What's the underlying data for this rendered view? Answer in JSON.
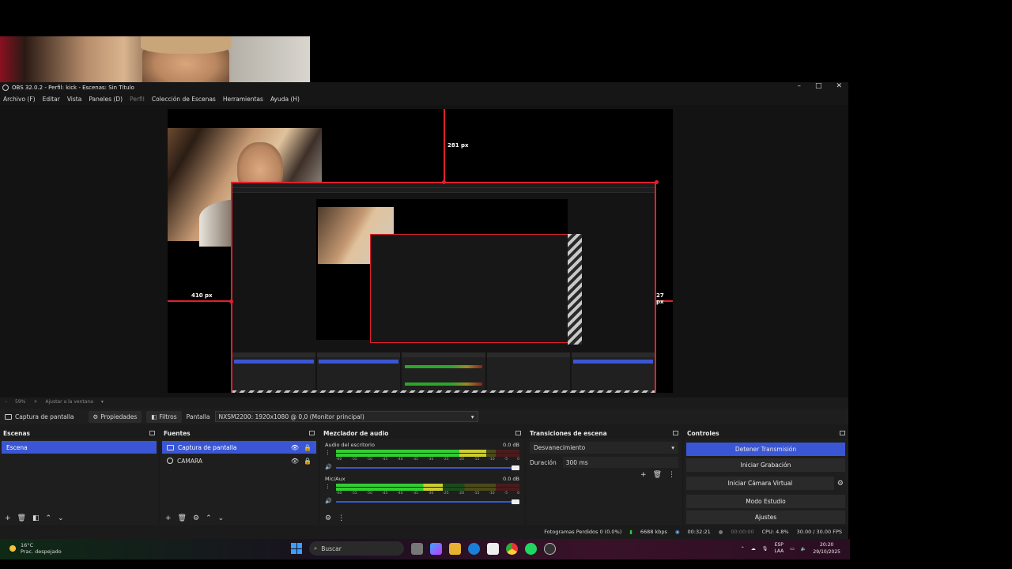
{
  "window": {
    "title": "OBS 32.0.2 - Perfil: kick - Escenas: Sin Título"
  },
  "menu": [
    "Archivo (F)",
    "Editar",
    "Vista",
    "Paneles (D)",
    "Perfil",
    "Colección de Escenas",
    "Herramientas",
    "Ayuda (H)"
  ],
  "preview": {
    "top_offset": "281 px",
    "left_offset": "410 px",
    "right_offset": "27 px"
  },
  "zoom": {
    "value": "59%",
    "fit_label": "Ajustar a la ventana"
  },
  "source_toolbar": {
    "source_name": "Captura de pantalla",
    "properties_label": "Propiedades",
    "filters_label": "Filtros",
    "display_label": "Pantalla",
    "display_value": "NXSM2200: 1920x1080 @ 0,0 (Monitor principal)"
  },
  "scenes": {
    "title": "Escenas",
    "items": [
      "Escena"
    ]
  },
  "sources": {
    "title": "Fuentes",
    "items": [
      "Captura de pantalla",
      "CAMARA"
    ]
  },
  "mixer": {
    "title": "Mezclador de audio",
    "tracks": [
      {
        "name": "Audio del escritorio",
        "db": "0.0 dB",
        "level": 0.82
      },
      {
        "name": "Mic/Aux",
        "db": "0.0 dB",
        "level": 0.58
      }
    ],
    "ticks": [
      "-60",
      "-55",
      "-50",
      "-45",
      "-40",
      "-35",
      "-30",
      "-25",
      "-20",
      "-15",
      "-10",
      "-5",
      "0"
    ]
  },
  "transitions": {
    "title": "Transiciones de escena",
    "selected": "Desvanecimiento",
    "duration_label": "Duración",
    "duration_value": "300 ms"
  },
  "controls": {
    "title": "Controles",
    "stop_stream": "Detener Transmisión",
    "start_recording": "Iniciar Grabación",
    "start_virtual_cam": "Iniciar Cámara Virtual",
    "studio_mode": "Modo Estudio",
    "settings": "Ajustes"
  },
  "status": {
    "dropped_frames": "Fotogramas Perdidos 0 (0.0%)",
    "bitrate": "6688 kbps",
    "stream_time": "00:32:21",
    "rec_time": "00:00:00",
    "cpu": "CPU: 4.8%",
    "fps": "30.00 / 30.00 FPS"
  },
  "taskbar": {
    "temperature": "16°C",
    "weather": "Prac. despejado",
    "search": "Buscar",
    "lang_top": "ESP",
    "lang_bottom": "LAA",
    "time": "20:20",
    "date": "29/10/2025"
  },
  "colors": {
    "accent": "#3a56d4",
    "selection": "#e0202c"
  }
}
